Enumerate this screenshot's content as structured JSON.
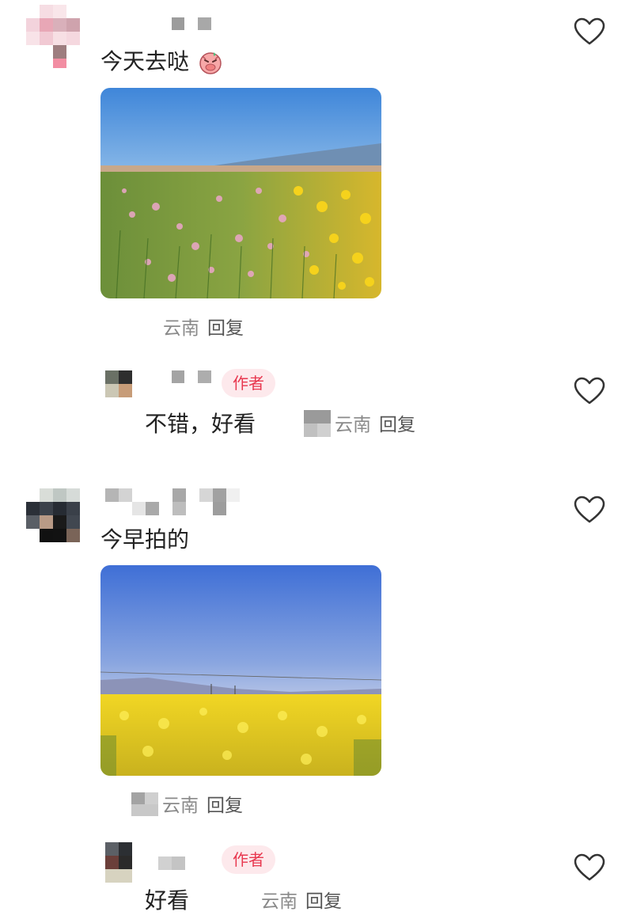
{
  "comments": [
    {
      "text": "今天去哒",
      "emoji": "laughing-pig-sticker",
      "meta": {
        "location": "云南",
        "reply_label": "回复"
      },
      "photo": {
        "subject": "flower-field-pink-yellow"
      },
      "replies": [
        {
          "badge": "作者",
          "text": "不错，好看",
          "meta": {
            "location": "云南",
            "reply_label": "回复"
          }
        }
      ]
    },
    {
      "text": "今早拍的",
      "meta": {
        "location": "云南",
        "reply_label": "回复"
      },
      "photo": {
        "subject": "yellow-rapeseed-field"
      },
      "replies": [
        {
          "badge": "作者",
          "text": "好看",
          "meta": {
            "location": "云南",
            "reply_label": "回复"
          }
        }
      ]
    }
  ],
  "colors": {
    "accent": "#e8384f",
    "badge_bg": "#fde9ec",
    "meta": "#8a8a8a"
  },
  "icons": {
    "like": "heart-outline-icon"
  }
}
